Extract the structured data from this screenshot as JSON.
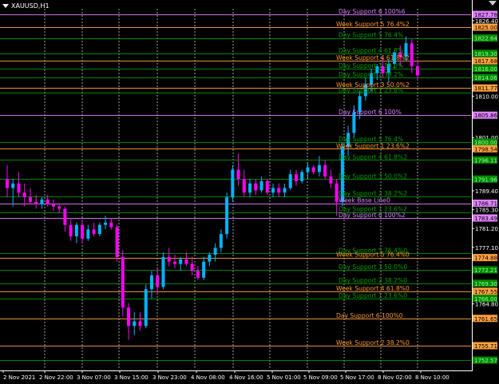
{
  "window": {
    "symbol_title": "XAUUSD,H1"
  },
  "colors": {
    "background": "#000000",
    "bull_candle": "#00b4ff",
    "bear_candle": "#ff00ff",
    "grid": "#ffffff",
    "day_line": "#e080ff",
    "week_line": "#ffa040",
    "green_line": "#00b000",
    "green_label": "#00a000",
    "orange_label": "#ff9933",
    "violet_label": "#d97fff",
    "axis_text": "#ffffff"
  },
  "price_axis": {
    "ticks": [
      "1826.40",
      "1810.00",
      "1801.00",
      "1789.40",
      "1785.30",
      "1781.20",
      "1777.10",
      "1764.80"
    ],
    "price_min": 1750.5,
    "price_max": 1829.0
  },
  "price_badges": [
    {
      "value": "1827.78",
      "kind": "day"
    },
    {
      "value": "1825.00",
      "kind": "week"
    },
    {
      "value": "1822.64",
      "kind": "green"
    },
    {
      "value": "1819.30",
      "kind": "green"
    },
    {
      "value": "1817.68",
      "kind": "week"
    },
    {
      "value": "1816.00",
      "kind": "green"
    },
    {
      "value": "1814.06",
      "kind": "green"
    },
    {
      "value": "1811.77",
      "kind": "week"
    },
    {
      "value": "1805.86",
      "kind": "day"
    },
    {
      "value": "1800.00",
      "kind": "green"
    },
    {
      "value": "1798.54",
      "kind": "week"
    },
    {
      "value": "1796.11",
      "kind": "green"
    },
    {
      "value": "1791.96",
      "kind": "green"
    },
    {
      "value": "1786.71",
      "kind": "day"
    },
    {
      "value": "1783.49",
      "kind": "day"
    },
    {
      "value": "1774.88",
      "kind": "week"
    },
    {
      "value": "1772.21",
      "kind": "green"
    },
    {
      "value": "1769.30",
      "kind": "green"
    },
    {
      "value": "1767.55",
      "kind": "week"
    },
    {
      "value": "1766.00",
      "kind": "green"
    },
    {
      "value": "1761.65",
      "kind": "week"
    },
    {
      "value": "1755.71",
      "kind": "week"
    },
    {
      "value": "1752.57",
      "kind": "green"
    }
  ],
  "levels": [
    {
      "price": 1827.78,
      "kind": "day",
      "label": "Day Support 6 100%6"
    },
    {
      "price": 1825.0,
      "kind": "week",
      "label": "Week Support 5 76.4%2"
    },
    {
      "price": 1822.64,
      "kind": "green",
      "label": "Day Support 5 76.4%"
    },
    {
      "price": 1819.3,
      "kind": "green",
      "label": "Day Support 4 61.8%"
    },
    {
      "price": 1817.68,
      "kind": "week",
      "label": "Week Support 4 61.8%2"
    },
    {
      "price": 1816.0,
      "kind": "green",
      "label": "Day Support 3 50.0%"
    },
    {
      "price": 1814.06,
      "kind": "green",
      "label": "Day Support 2 38.2%"
    },
    {
      "price": 1811.77,
      "kind": "week",
      "label": "Week Support 3 50.0%2"
    },
    {
      "price": 1810.7,
      "kind": "green",
      "label": "Day Support 1 23.6%"
    },
    {
      "price": 1805.86,
      "kind": "day",
      "label": "Day Support 6 100%"
    },
    {
      "price": 1800.0,
      "kind": "green",
      "label": "Day Support 5 76.4%"
    },
    {
      "price": 1798.54,
      "kind": "week",
      "label": "Week Support 1 23.6%2"
    },
    {
      "price": 1796.11,
      "kind": "green",
      "label": "Day Support 4 61.8%2"
    },
    {
      "price": 1791.96,
      "kind": "green",
      "label": "Day Support 3 50.0%2"
    },
    {
      "price": 1788.2,
      "kind": "green",
      "label": "Day Support 2 38.2%2"
    },
    {
      "price": 1784.8,
      "kind": "green",
      "label": "Day Support 1 23.6%2"
    },
    {
      "price": 1786.71,
      "kind": "day",
      "label": "Week Base Line0"
    },
    {
      "price": 1783.49,
      "kind": "day",
      "label": "Day Support 6 100%2"
    },
    {
      "price": 1775.8,
      "kind": "green",
      "label": "Day Support 5 76.4%0"
    },
    {
      "price": 1774.88,
      "kind": "week",
      "label": "Week Support 5 76.4%0"
    },
    {
      "price": 1772.21,
      "kind": "green",
      "label": "Day Support 3 50.0%0"
    },
    {
      "price": 1769.3,
      "kind": "green",
      "label": "Day Support 2 38.2%0"
    },
    {
      "price": 1767.55,
      "kind": "week",
      "label": "Week Support 4 61.8%0"
    },
    {
      "price": 1766.0,
      "kind": "green",
      "label": "Day Support 1 23.6%0"
    },
    {
      "price": 1761.65,
      "kind": "week",
      "label": "Day Support 6 100%0"
    },
    {
      "price": 1755.71,
      "kind": "week",
      "label": "Week Support 2 38.2%0"
    },
    {
      "price": 1752.57,
      "kind": "green",
      "label": ""
    }
  ],
  "time_axis": {
    "labels": [
      "2 Nov 2021",
      "2 Nov 22:00",
      "3 Nov 07:00",
      "3 Nov 15:00",
      "3 Nov 23:00",
      "4 Nov 08:00",
      "4 Nov 16:00",
      "5 Nov 01:00",
      "5 Nov 09:00",
      "5 Nov 17:00",
      "8 Nov 02:00",
      "8 Nov 10:00"
    ]
  },
  "candles": [
    {
      "o": 1792.0,
      "h": 1795.0,
      "l": 1788.0,
      "c": 1790.0
    },
    {
      "o": 1790.0,
      "h": 1792.0,
      "l": 1786.0,
      "c": 1791.0
    },
    {
      "o": 1791.0,
      "h": 1793.5,
      "l": 1788.0,
      "c": 1789.0
    },
    {
      "o": 1789.0,
      "h": 1791.0,
      "l": 1786.0,
      "c": 1788.0
    },
    {
      "o": 1788.0,
      "h": 1790.0,
      "l": 1786.5,
      "c": 1787.0
    },
    {
      "o": 1787.0,
      "h": 1788.5,
      "l": 1785.5,
      "c": 1786.5
    },
    {
      "o": 1786.5,
      "h": 1788.0,
      "l": 1785.5,
      "c": 1787.5
    },
    {
      "o": 1787.5,
      "h": 1788.5,
      "l": 1786.0,
      "c": 1786.5
    },
    {
      "o": 1786.5,
      "h": 1787.5,
      "l": 1785.0,
      "c": 1786.0
    },
    {
      "o": 1786.0,
      "h": 1786.5,
      "l": 1784.5,
      "c": 1785.5
    },
    {
      "o": 1785.5,
      "h": 1786.0,
      "l": 1780.5,
      "c": 1782.0
    },
    {
      "o": 1782.0,
      "h": 1783.5,
      "l": 1778.5,
      "c": 1779.5
    },
    {
      "o": 1779.5,
      "h": 1782.5,
      "l": 1778.0,
      "c": 1782.0
    },
    {
      "o": 1782.0,
      "h": 1783.0,
      "l": 1778.0,
      "c": 1779.0
    },
    {
      "o": 1779.0,
      "h": 1782.0,
      "l": 1778.5,
      "c": 1781.0
    },
    {
      "o": 1781.0,
      "h": 1782.5,
      "l": 1779.5,
      "c": 1780.0
    },
    {
      "o": 1780.0,
      "h": 1782.5,
      "l": 1779.5,
      "c": 1782.0
    },
    {
      "o": 1782.0,
      "h": 1784.0,
      "l": 1781.0,
      "c": 1782.5
    },
    {
      "o": 1782.5,
      "h": 1783.5,
      "l": 1781.0,
      "c": 1781.5
    },
    {
      "o": 1781.5,
      "h": 1782.0,
      "l": 1774.0,
      "c": 1775.0
    },
    {
      "o": 1775.0,
      "h": 1776.5,
      "l": 1762.0,
      "c": 1764.0
    },
    {
      "o": 1764.0,
      "h": 1765.0,
      "l": 1757.0,
      "c": 1760.0
    },
    {
      "o": 1760.0,
      "h": 1763.0,
      "l": 1758.0,
      "c": 1761.0
    },
    {
      "o": 1761.0,
      "h": 1763.0,
      "l": 1759.0,
      "c": 1760.0
    },
    {
      "o": 1760.0,
      "h": 1769.0,
      "l": 1759.5,
      "c": 1768.0
    },
    {
      "o": 1768.0,
      "h": 1772.0,
      "l": 1766.0,
      "c": 1771.0
    },
    {
      "o": 1771.0,
      "h": 1772.5,
      "l": 1767.0,
      "c": 1768.5
    },
    {
      "o": 1768.5,
      "h": 1776.0,
      "l": 1768.0,
      "c": 1775.0
    },
    {
      "o": 1775.0,
      "h": 1777.0,
      "l": 1773.0,
      "c": 1774.0
    },
    {
      "o": 1774.0,
      "h": 1775.5,
      "l": 1772.5,
      "c": 1773.5
    },
    {
      "o": 1773.5,
      "h": 1775.0,
      "l": 1772.0,
      "c": 1774.5
    },
    {
      "o": 1774.5,
      "h": 1776.0,
      "l": 1773.0,
      "c": 1773.5
    },
    {
      "o": 1773.5,
      "h": 1775.0,
      "l": 1771.0,
      "c": 1772.0
    },
    {
      "o": 1772.0,
      "h": 1773.0,
      "l": 1770.0,
      "c": 1770.5
    },
    {
      "o": 1770.5,
      "h": 1775.0,
      "l": 1770.0,
      "c": 1774.0
    },
    {
      "o": 1774.0,
      "h": 1776.0,
      "l": 1773.0,
      "c": 1775.5
    },
    {
      "o": 1775.5,
      "h": 1778.0,
      "l": 1774.0,
      "c": 1777.0
    },
    {
      "o": 1777.0,
      "h": 1781.0,
      "l": 1776.0,
      "c": 1780.0
    },
    {
      "o": 1780.0,
      "h": 1789.0,
      "l": 1779.0,
      "c": 1788.0
    },
    {
      "o": 1788.0,
      "h": 1795.0,
      "l": 1787.0,
      "c": 1794.0
    },
    {
      "o": 1794.0,
      "h": 1797.5,
      "l": 1790.5,
      "c": 1792.0
    },
    {
      "o": 1792.0,
      "h": 1794.0,
      "l": 1788.0,
      "c": 1789.0
    },
    {
      "o": 1789.0,
      "h": 1792.0,
      "l": 1788.0,
      "c": 1791.0
    },
    {
      "o": 1791.0,
      "h": 1792.0,
      "l": 1788.5,
      "c": 1789.5
    },
    {
      "o": 1789.5,
      "h": 1792.5,
      "l": 1789.0,
      "c": 1791.5
    },
    {
      "o": 1791.5,
      "h": 1792.0,
      "l": 1788.5,
      "c": 1789.0
    },
    {
      "o": 1789.0,
      "h": 1791.0,
      "l": 1788.0,
      "c": 1790.0
    },
    {
      "o": 1790.0,
      "h": 1791.0,
      "l": 1788.0,
      "c": 1789.0
    },
    {
      "o": 1789.0,
      "h": 1791.0,
      "l": 1788.0,
      "c": 1790.0
    },
    {
      "o": 1790.0,
      "h": 1794.0,
      "l": 1789.5,
      "c": 1793.0
    },
    {
      "o": 1793.0,
      "h": 1794.0,
      "l": 1790.5,
      "c": 1791.5
    },
    {
      "o": 1791.5,
      "h": 1794.0,
      "l": 1791.0,
      "c": 1793.5
    },
    {
      "o": 1793.5,
      "h": 1795.5,
      "l": 1792.0,
      "c": 1794.5
    },
    {
      "o": 1794.5,
      "h": 1795.0,
      "l": 1793.0,
      "c": 1793.5
    },
    {
      "o": 1793.5,
      "h": 1797.0,
      "l": 1792.5,
      "c": 1795.0
    },
    {
      "o": 1795.0,
      "h": 1796.0,
      "l": 1792.0,
      "c": 1792.5
    },
    {
      "o": 1792.5,
      "h": 1794.0,
      "l": 1790.0,
      "c": 1791.0
    },
    {
      "o": 1791.0,
      "h": 1792.0,
      "l": 1784.0,
      "c": 1787.0
    },
    {
      "o": 1787.0,
      "h": 1800.0,
      "l": 1786.0,
      "c": 1799.0
    },
    {
      "o": 1799.0,
      "h": 1803.5,
      "l": 1797.0,
      "c": 1802.0
    },
    {
      "o": 1802.0,
      "h": 1808.0,
      "l": 1801.0,
      "c": 1806.5
    },
    {
      "o": 1806.5,
      "h": 1811.0,
      "l": 1805.0,
      "c": 1810.0
    },
    {
      "o": 1810.0,
      "h": 1814.0,
      "l": 1809.0,
      "c": 1812.5
    },
    {
      "o": 1812.5,
      "h": 1816.0,
      "l": 1811.0,
      "c": 1815.0
    },
    {
      "o": 1815.0,
      "h": 1817.0,
      "l": 1813.5,
      "c": 1816.5
    },
    {
      "o": 1816.5,
      "h": 1818.5,
      "l": 1814.0,
      "c": 1815.0
    },
    {
      "o": 1815.0,
      "h": 1818.0,
      "l": 1813.0,
      "c": 1817.0
    },
    {
      "o": 1817.0,
      "h": 1820.0,
      "l": 1816.0,
      "c": 1819.5
    },
    {
      "o": 1819.5,
      "h": 1821.0,
      "l": 1816.5,
      "c": 1818.5
    },
    {
      "o": 1818.5,
      "h": 1823.0,
      "l": 1817.5,
      "c": 1821.5
    },
    {
      "o": 1821.5,
      "h": 1822.5,
      "l": 1815.0,
      "c": 1816.5
    },
    {
      "o": 1816.5,
      "h": 1818.0,
      "l": 1813.5,
      "c": 1814.5
    }
  ]
}
